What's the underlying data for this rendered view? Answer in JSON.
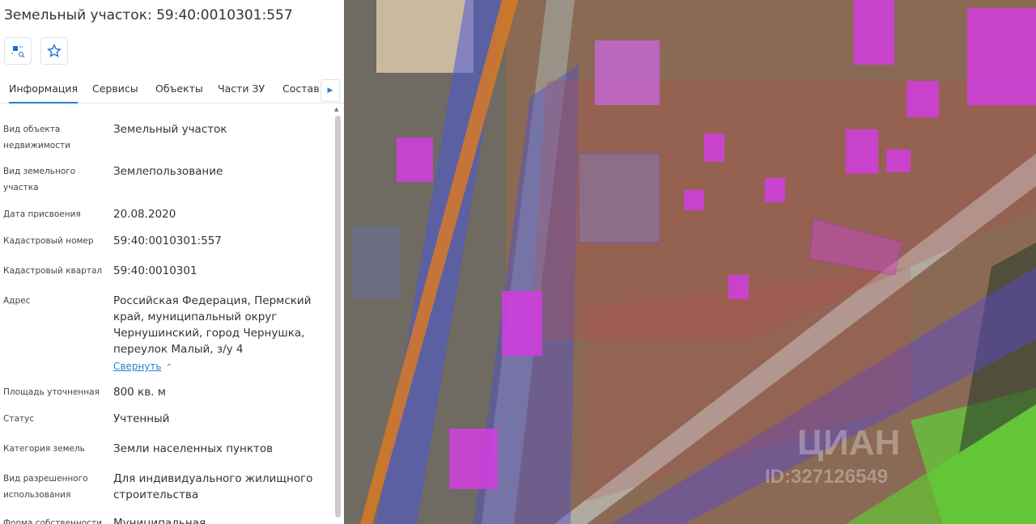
{
  "header": {
    "title": "Земельный участок: 59:40:0010301:557"
  },
  "toolbar": {
    "buttons": [
      {
        "icon": "select-zoom-icon"
      },
      {
        "icon": "star-icon"
      }
    ]
  },
  "tabs": [
    {
      "label": "Информация",
      "active": true
    },
    {
      "label": "Сервисы"
    },
    {
      "label": "Объекты"
    },
    {
      "label": "Части ЗУ"
    },
    {
      "label": "Состав"
    }
  ],
  "info": [
    {
      "label": "Вид объекта недвижимости",
      "value": "Земельный участок"
    },
    {
      "label": "Вид земельного участка",
      "value": "Землепользование"
    },
    {
      "label": "Дата присвоения",
      "value": "20.08.2020"
    },
    {
      "label": "Кадастровый номер",
      "value": "59:40:0010301:557"
    },
    {
      "label": "Кадастровый квартал",
      "value": "59:40:0010301"
    },
    {
      "label": "Адрес",
      "value": "Российская Федерация, Пермский край, муниципальный округ Чернушинский, город Чернушка, переулок Малый, з/у 4",
      "collapse_link": "Свернуть"
    },
    {
      "label": "Площадь уточненная",
      "value": "800 кв. м"
    },
    {
      "label": "Статус",
      "value": "Учтенный"
    },
    {
      "label": "Категория земель",
      "value": "Земли населенных пунктов"
    },
    {
      "label": "Вид разрешенного использования",
      "value": "Для индивидуального жилищного строительства"
    },
    {
      "label": "Форма собственности",
      "value": "Муниципальная"
    }
  ],
  "map": {
    "watermark": "ЦИАН",
    "watermark_id": "ID:327126549"
  }
}
